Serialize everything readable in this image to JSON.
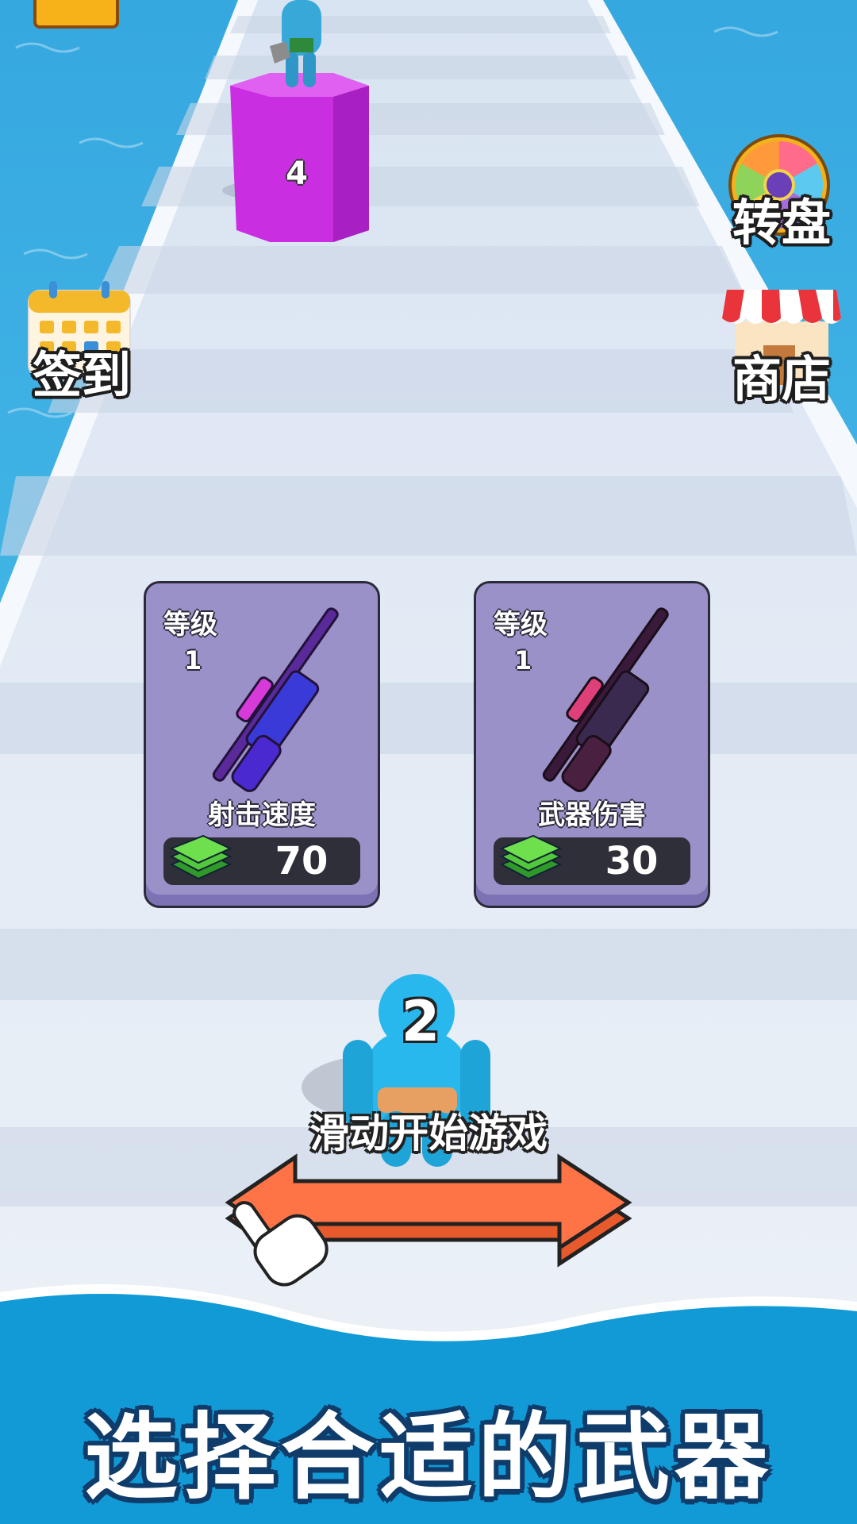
{
  "pillar": {
    "number": "4"
  },
  "player": {
    "number": "2"
  },
  "side_buttons": {
    "wheel_label": "转盘",
    "checkin_label": "签到",
    "shop_label": "商店"
  },
  "cards": [
    {
      "level_label": "等级",
      "level": "1",
      "stat": "射击速度",
      "price": "70"
    },
    {
      "level_label": "等级",
      "level": "1",
      "stat": "武器伤害",
      "price": "30"
    }
  ],
  "hint": {
    "text": "滑动开始游戏"
  },
  "banner": {
    "title": "选择合适的武器"
  },
  "colors": {
    "water": "#3fb6e6",
    "track": "#e4ecf6",
    "pillar": "#c92ee0",
    "player": "#29b8ee",
    "card": "#9b91c9",
    "arrow": "#ff7446",
    "banner": "#129ad6"
  }
}
